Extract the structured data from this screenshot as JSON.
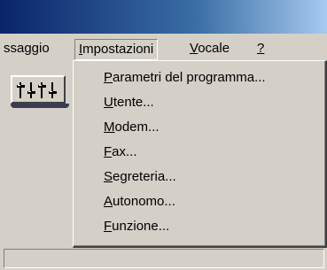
{
  "menubar": {
    "items": [
      {
        "label": "ssaggio"
      },
      {
        "label": "Impostazioni",
        "mnemonic": "I",
        "rest": "mpostazioni"
      },
      {
        "label": "Vocale",
        "mnemonic": "V",
        "rest": "ocale"
      },
      {
        "label": "?",
        "mnemonic": "?"
      }
    ]
  },
  "dropdown": {
    "items": [
      {
        "label": "Parametri del programma...",
        "mnemonic": "P",
        "rest": "arametri del programma..."
      },
      {
        "label": "Utente...",
        "mnemonic": "U",
        "rest": "tente..."
      },
      {
        "label": "Modem...",
        "mnemonic": "M",
        "rest": "odem..."
      },
      {
        "label": "Fax...",
        "mnemonic": "F",
        "rest": "ax..."
      },
      {
        "label": "Segreteria...",
        "mnemonic": "S",
        "rest": "egreteria..."
      },
      {
        "label": "Autonomo...",
        "mnemonic": "A",
        "rest": "utonomo..."
      },
      {
        "label": "Funzione...",
        "mnemonic": "F",
        "rest": "unzione..."
      }
    ]
  },
  "icons": {
    "toolbar_button": "equalizer-sliders-icon"
  },
  "colors": {
    "titlebar_start": "#0a246a",
    "titlebar_end": "#a6caf0",
    "face": "#d4d0c8"
  }
}
